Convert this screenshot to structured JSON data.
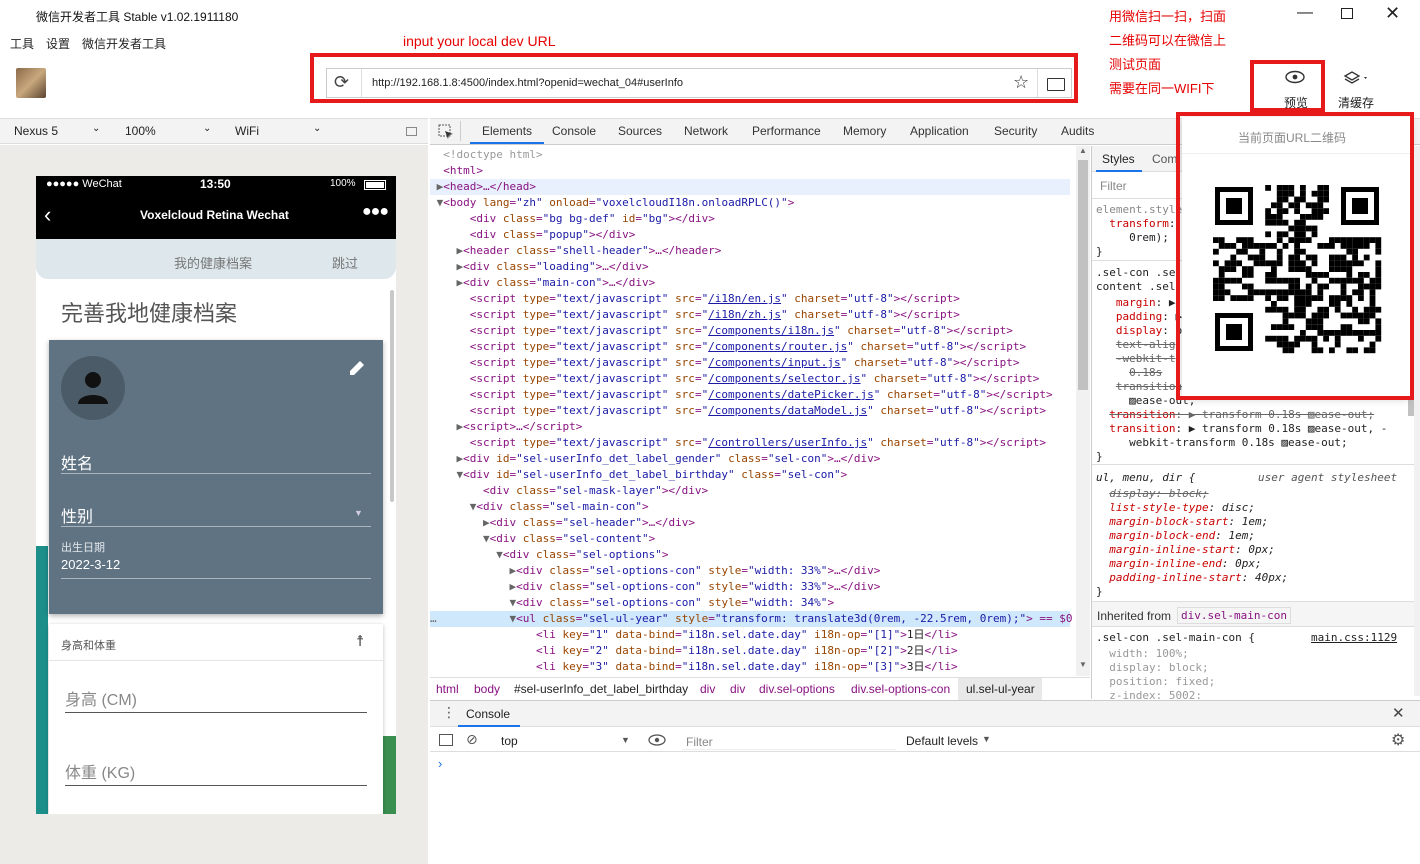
{
  "window": {
    "title": "微信开发者工具 Stable v1.02.1911180"
  },
  "menu": [
    "工具",
    "设置",
    "微信开发者工具"
  ],
  "annotations": {
    "url_note": "input your local dev URL",
    "preview_note": [
      "用微信扫一扫，扫面",
      "二维码可以在微信上",
      "测试页面",
      "需要在同一WIFI下"
    ]
  },
  "address": {
    "url": "http://192.168.1.8:4500/index.html?openid=wechat_04#userInfo"
  },
  "toolbar": {
    "preview": "预览",
    "clear_cache": "清缓存"
  },
  "device": {
    "model": "Nexus 5",
    "zoom": "100%",
    "network": "WiFi"
  },
  "qr": {
    "title": "当前页面URL二维码"
  },
  "phone": {
    "carrier": "●●●●● WeChat",
    "time": "13:50",
    "battery": "100%",
    "nav_title": "Voxelcloud Retina Wechat",
    "sub_header": "我的健康档案",
    "skip": "跳过",
    "heading": "完善我地健康档案",
    "name_label": "姓名",
    "gender_label": "性别",
    "birth_label": "出生日期",
    "birth_value": "2022-3-12",
    "card2_title": "身高和体重",
    "height_label": "身高 (CM)",
    "weight_label": "体重 (KG)"
  },
  "devtools": {
    "tabs": [
      "Elements",
      "Console",
      "Sources",
      "Network",
      "Performance",
      "Memory",
      "Application",
      "Security",
      "Audits"
    ],
    "active_tab": "Elements",
    "breadcrumb": [
      "html",
      "body",
      "#sel-userInfo_det_label_birthday",
      "div",
      "div",
      "div.sel-options",
      "div.sel-options-con",
      "ul.sel-ul-year"
    ],
    "styles_tabs": [
      "Styles",
      "Com"
    ],
    "filter_placeholder": "Filter",
    "inherited_label": "Inherited from",
    "inherited_from": "div.sel-main-con",
    "ua_label": "user agent stylesheet",
    "main_css": "main.css:1129"
  },
  "console": {
    "tab": "Console",
    "context": "top",
    "filter_placeholder": "Filter",
    "levels": "Default levels"
  }
}
